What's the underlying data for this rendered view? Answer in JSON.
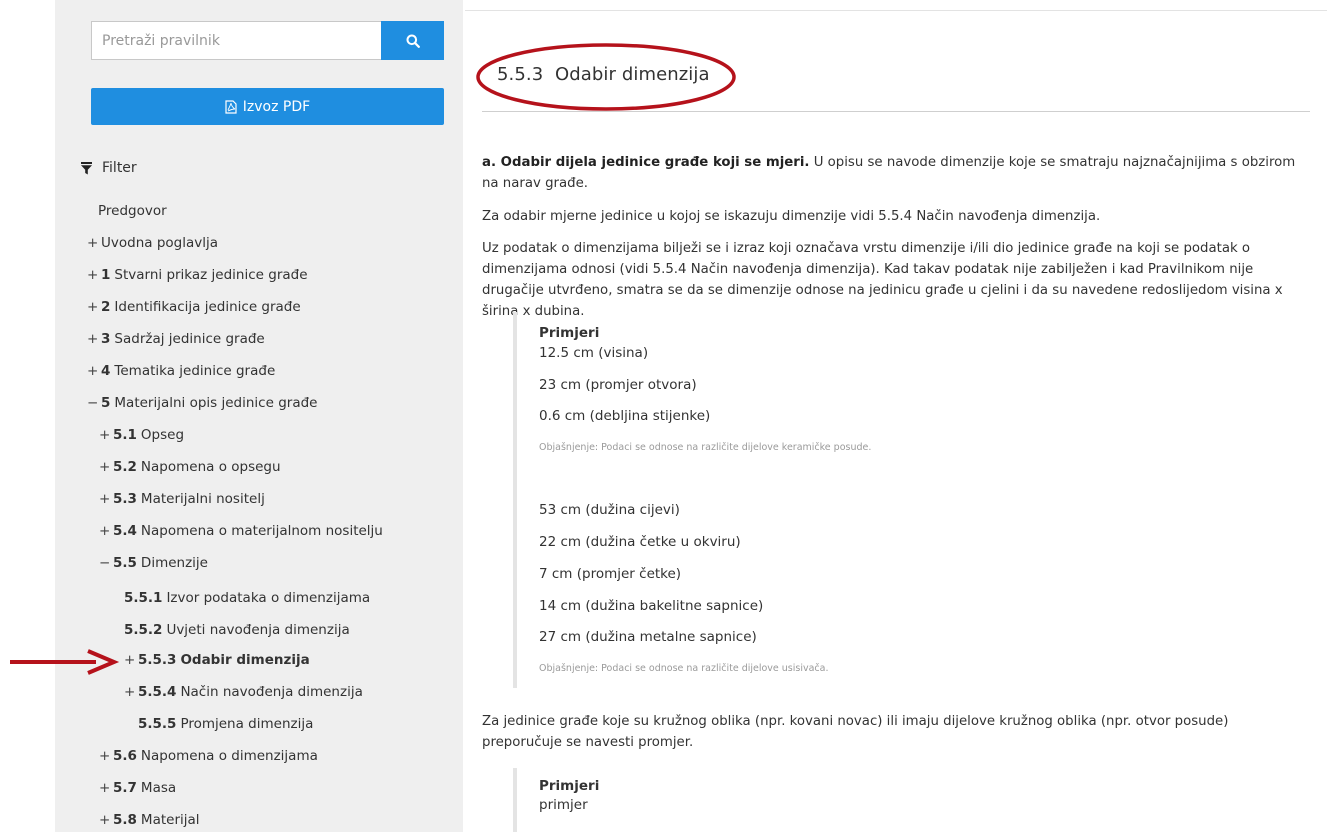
{
  "sidebar": {
    "search_placeholder": "Pretraži pravilnik",
    "pdf_label": "Izvoz PDF",
    "filter_label": "Filter",
    "toc": [
      {
        "sign": "",
        "num": "",
        "label": "Predgovor"
      },
      {
        "sign": "+",
        "num": "",
        "label": "Uvodna poglavlja"
      },
      {
        "sign": "+",
        "num": "1",
        "label": "Stvarni prikaz jedinice građe"
      },
      {
        "sign": "+",
        "num": "2",
        "label": "Identifikacija jedinice građe"
      },
      {
        "sign": "+",
        "num": "3",
        "label": "Sadržaj jedinice građe"
      },
      {
        "sign": "+",
        "num": "4",
        "label": "Tematika jedinice građe"
      },
      {
        "sign": "−",
        "num": "5",
        "label": "Materijalni opis jedinice građe"
      },
      {
        "sign": "+",
        "num": "5.1",
        "label": "Opseg"
      },
      {
        "sign": "+",
        "num": "5.2",
        "label": "Napomena o opsegu"
      },
      {
        "sign": "+",
        "num": "5.3",
        "label": "Materijalni nositelj"
      },
      {
        "sign": "+",
        "num": "5.4",
        "label": "Napomena o materijalnom nositelju"
      },
      {
        "sign": "−",
        "num": "5.5",
        "label": "Dimenzije"
      },
      {
        "sign": "",
        "num": "5.5.1",
        "label": "Izvor podataka o dimenzijama"
      },
      {
        "sign": "",
        "num": "5.5.2",
        "label": "Uvjeti navođenja dimenzija"
      },
      {
        "sign": "+",
        "num": "5.5.3",
        "label": "Odabir dimenzija"
      },
      {
        "sign": "+",
        "num": "5.5.4",
        "label": "Način navođenja dimenzija"
      },
      {
        "sign": "",
        "num": "5.5.5",
        "label": "Promjena dimenzija"
      },
      {
        "sign": "+",
        "num": "5.6",
        "label": "Napomena o dimenzijama"
      },
      {
        "sign": "+",
        "num": "5.7",
        "label": "Masa"
      },
      {
        "sign": "+",
        "num": "5.8",
        "label": "Materijal"
      }
    ]
  },
  "content": {
    "title": "5.5.3  Odabir dimenzija",
    "p1_bold": "a. Odabir dijela jedinice građe koji se mjeri.",
    "p1_rest": " U opisu se navode dimenzije koje se smatraju najznačajnijima s obzirom na narav građe.",
    "p2": "Za odabir mjerne jedinice u kojoj se iskazuju dimenzije vidi 5.5.4 Način navođenja dimenzija.",
    "p3": "Uz podatak o dimenzijama bilježi se i izraz koji označava vrstu dimenzije i/ili dio jedinice građe na koji se podatak o dimenzijama odnosi (vidi 5.5.4 Način navođenja dimenzija). Kad takav podatak nije zabilježen i kad Pravilnikom nije drugačije utvrđeno, smatra se da se dimenzije odnose na jedinicu građe u cjelini i da su navedene redoslijedom visina x širina x dubina.",
    "examples1": {
      "heading": "Primjeri",
      "group1": [
        "12.5 cm (visina)",
        "23 cm (promjer otvora)",
        "0.6 cm (debljina stijenke)"
      ],
      "note1": "Objašnjenje: Podaci se odnose na različite dijelove keramičke posude.",
      "group2": [
        "53 cm (dužina cijevi)",
        "22 cm (dužina četke u okviru)",
        "7 cm (promjer četke)",
        "14 cm (dužina bakelitne sapnice)",
        "27 cm (dužina metalne sapnice)"
      ],
      "note2": "Objašnjenje: Podaci se odnose na različite dijelove usisivača."
    },
    "p4": "Za jedinice građe koje su kružnog oblika (npr. kovani novac) ili imaju dijelove kružnog oblika (npr. otvor posude) preporučuje se navesti promjer.",
    "examples2": {
      "heading": "Primjeri",
      "line": "primjer"
    }
  },
  "colors": {
    "accent": "#1f8ee0",
    "annotation": "#b5121b",
    "sidebar_bg": "#efefef"
  }
}
